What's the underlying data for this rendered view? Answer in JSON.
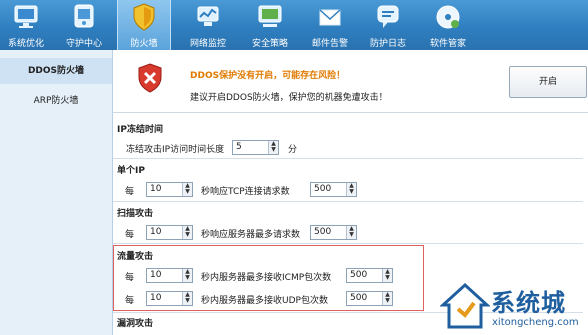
{
  "toolbar": {
    "items": [
      {
        "label": "系统优化",
        "icon": "monitor-icon"
      },
      {
        "label": "守护中心",
        "icon": "device-icon"
      },
      {
        "label": "防火墙",
        "icon": "shield-icon",
        "active": true
      },
      {
        "label": "网络监控",
        "icon": "network-icon"
      },
      {
        "label": "安全策略",
        "icon": "monitor-check-icon"
      },
      {
        "label": "邮件告警",
        "icon": "mail-icon"
      },
      {
        "label": "防护日志",
        "icon": "chat-log-icon"
      },
      {
        "label": "软件管家",
        "icon": "disc-icon"
      }
    ]
  },
  "sidebar": {
    "items": [
      {
        "label": "DDOS防火墙",
        "active": true
      },
      {
        "label": "ARP防火墙",
        "active": false
      }
    ]
  },
  "banner": {
    "title": "DDOS保护没有开启，可能存在风险！",
    "desc": "建议开启DDOS防火墙，保护您的机器免遭攻击！",
    "button": "开启"
  },
  "sections": {
    "ip_freeze": {
      "title": "IP冻结时间",
      "label": "冻结攻击IP访问时间长度",
      "value": "5",
      "unit": "分"
    },
    "single_ip": {
      "title": "单个IP",
      "prefix": "每",
      "seconds": "10",
      "label": "秒响应TCP连接请求数",
      "count": "500"
    },
    "scan": {
      "title": "扫描攻击",
      "prefix": "每",
      "seconds": "10",
      "label": "秒响应服务器最多请求数",
      "count": "500"
    },
    "flood": {
      "title": "流量攻击",
      "rows": [
        {
          "prefix": "每",
          "seconds": "10",
          "label": "秒内服务器最多接收ICMP包次数",
          "count": "500"
        },
        {
          "prefix": "每",
          "seconds": "10",
          "label": "秒内服务器最多接收UDP包次数",
          "count": "500"
        }
      ]
    },
    "vuln": {
      "title": "漏洞攻击"
    }
  },
  "watermark": {
    "text": "系统城",
    "url": "xitongcheng.com"
  },
  "colors": {
    "toolbar": "#2f7fc0",
    "warning_title": "#e07a00",
    "highlight_border": "#e06060",
    "sidebar_bg": "#e6f0f9"
  }
}
